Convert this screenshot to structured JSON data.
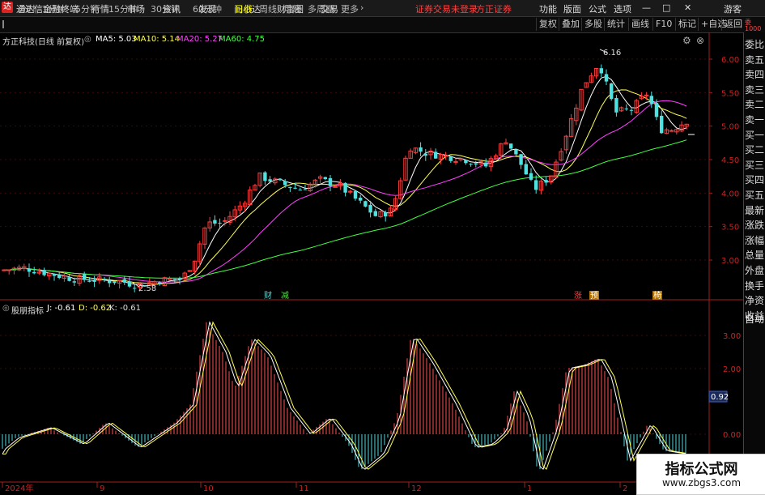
{
  "menubar": {
    "app_title": "通达信金融终端",
    "items": [
      "行情",
      "市场",
      "资讯",
      "发现",
      "问小达",
      "财富圈",
      "交易"
    ],
    "login_notice": "证券交易未登录",
    "broker": "方正证券",
    "right_items": [
      "功能",
      "版面",
      "公式",
      "选项"
    ],
    "user": "游客"
  },
  "periods": [
    "分时",
    "1分钟",
    "5分钟",
    "15分钟",
    "30分钟",
    "60分钟",
    "日线",
    "周线",
    "月线",
    "多周期",
    "更多"
  ],
  "active_period": "日线",
  "toolbar_right": [
    "复权",
    "叠加",
    "多股",
    "统计",
    "画线",
    "F10",
    "标记",
    "+自选",
    "返回"
  ],
  "main_legend": {
    "stock": "方正科技(日线 前复权)",
    "ma5": "MA5: 5.03",
    "ma10": "MA10: 5.14",
    "ma20": "MA20: 5.27",
    "ma60": "MA60: 4.75"
  },
  "price_axis": [
    "6.00",
    "5.50",
    "5.00",
    "4.50",
    "4.00",
    "3.50",
    "3.00"
  ],
  "annotations": {
    "high": "6.16",
    "low": "2.58"
  },
  "event_marks": [
    "财",
    "减",
    "涨",
    "预",
    "椅"
  ],
  "indicator_legend": {
    "name": "股朋指标",
    "j": "J: -0.61",
    "d": "D: -0.62",
    "k": "K: -0.61"
  },
  "indicator_axis": [
    "3.00",
    "2.00",
    "0.00"
  ],
  "indicator_current": "0.92",
  "date_axis": [
    "2024年",
    "9",
    "10",
    "11",
    "12",
    "1",
    "2"
  ],
  "right_panel": [
    "委比",
    "卖五",
    "卖四",
    "卖三",
    "卖二",
    "卖一",
    "买一",
    "买二",
    "买三",
    "买四",
    "买五",
    "最新",
    "涨跌",
    "涨幅",
    "总量",
    "外盘",
    "换手",
    "净资",
    "收益",
    "自动"
  ],
  "watermark": {
    "title": "指标公式网",
    "url": "www.zbgs3.com"
  },
  "colors": {
    "up": "#ff3b3b",
    "down": "#4fe0e0",
    "ma5": "#ffffff",
    "ma10": "#ffff55",
    "ma20": "#ff40ff",
    "ma60": "#40ff40"
  }
}
